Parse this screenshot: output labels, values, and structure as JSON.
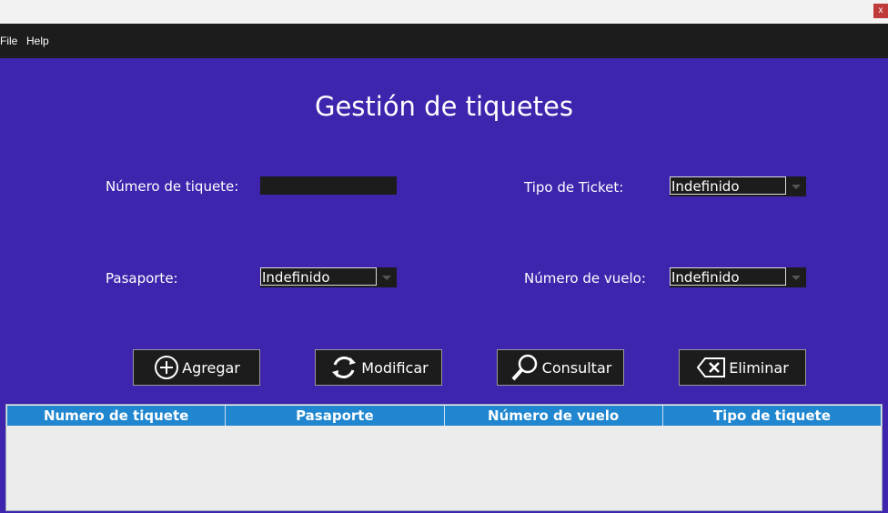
{
  "window": {
    "close_label": "x"
  },
  "menu": {
    "items": [
      "File",
      "Help"
    ]
  },
  "main": {
    "title": "Gestión de tiquetes"
  },
  "form": {
    "ticket_number_label": "Número de tiquete:",
    "ticket_number_value": "",
    "ticket_type_label": "Tipo de Ticket:",
    "ticket_type_value": "Indefinido",
    "passport_label": "Pasaporte:",
    "passport_value": "Indefinido",
    "flight_number_label": "Número de vuelo:",
    "flight_number_value": "Indefinido"
  },
  "buttons": {
    "add": {
      "label": "Agregar",
      "icon": "plus-circle-icon"
    },
    "modify": {
      "label": "Modificar",
      "icon": "refresh-icon"
    },
    "query": {
      "label": "Consultar",
      "icon": "search-icon"
    },
    "delete": {
      "label": "Eliminar",
      "icon": "backspace-icon"
    }
  },
  "table": {
    "columns": [
      "Numero de tiquete",
      "Pasaporte",
      "Número de vuelo",
      "Tipo de tiquete"
    ],
    "rows": []
  },
  "colors": {
    "background": "#3f24ad",
    "menubar": "#1c1c1c",
    "table_header": "#1f86cf",
    "close_button": "#c0393b"
  }
}
